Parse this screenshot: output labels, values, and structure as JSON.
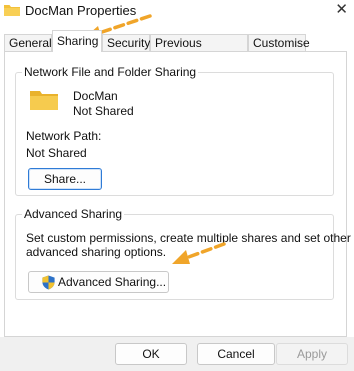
{
  "window": {
    "title": "DocMan Properties",
    "close_glyph": "✕"
  },
  "tabs": [
    {
      "label": "General",
      "active": false
    },
    {
      "label": "Sharing",
      "active": true
    },
    {
      "label": "Security",
      "active": false
    },
    {
      "label": "Previous Versions",
      "active": false
    },
    {
      "label": "Customise",
      "active": false
    }
  ],
  "network_sharing": {
    "group_title": "Network File and Folder Sharing",
    "folder_name": "DocMan",
    "share_status": "Not Shared",
    "network_path_label": "Network Path:",
    "network_path_value": "Not Shared",
    "share_button": "Share..."
  },
  "advanced_sharing": {
    "group_title": "Advanced Sharing",
    "description_line1": "Set custom permissions, create multiple shares and set other",
    "description_line2": "advanced sharing options.",
    "button": "Advanced Sharing..."
  },
  "footer": {
    "ok": "OK",
    "cancel": "Cancel",
    "apply": "Apply"
  },
  "icons": {
    "folder": "folder-icon",
    "shield": "uac-shield-icon",
    "annotation_arrow": "annotation-arrow-icon"
  },
  "colors": {
    "folder": "#f3c13a",
    "annotation_arrow": "#f0a52a",
    "focus_border": "#2f7bd6"
  }
}
